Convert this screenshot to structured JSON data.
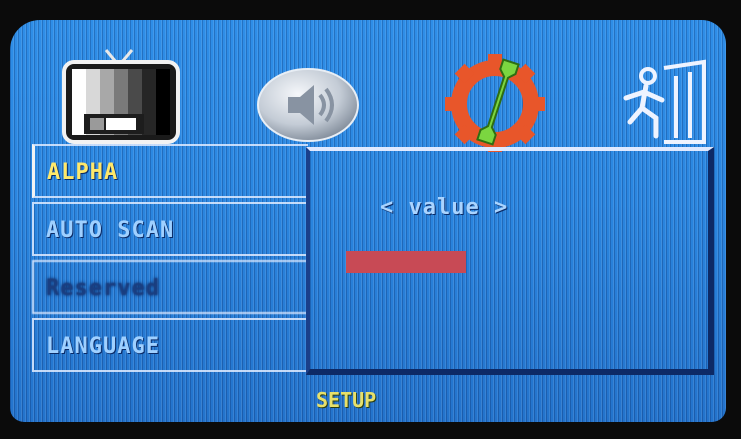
{
  "menu": {
    "items": [
      {
        "label": "ALPHA",
        "selected": true
      },
      {
        "label": "AUTO SCAN"
      },
      {
        "label": "Reserved",
        "disabled": true
      },
      {
        "label": "LANGUAGE"
      }
    ]
  },
  "panel": {
    "value_text": "< value >",
    "bar_color": "#c84a55"
  },
  "footer": {
    "label": "SETUP"
  },
  "icons": [
    "tv-icon",
    "speaker-icon",
    "setup-gear-wrench-icon",
    "exit-door-icon"
  ],
  "colors": {
    "screen_blue": "#2a86e0",
    "selected_text": "#ffe86a",
    "menu_text": "#9fd0ff",
    "footer_text": "#e7e06a"
  }
}
